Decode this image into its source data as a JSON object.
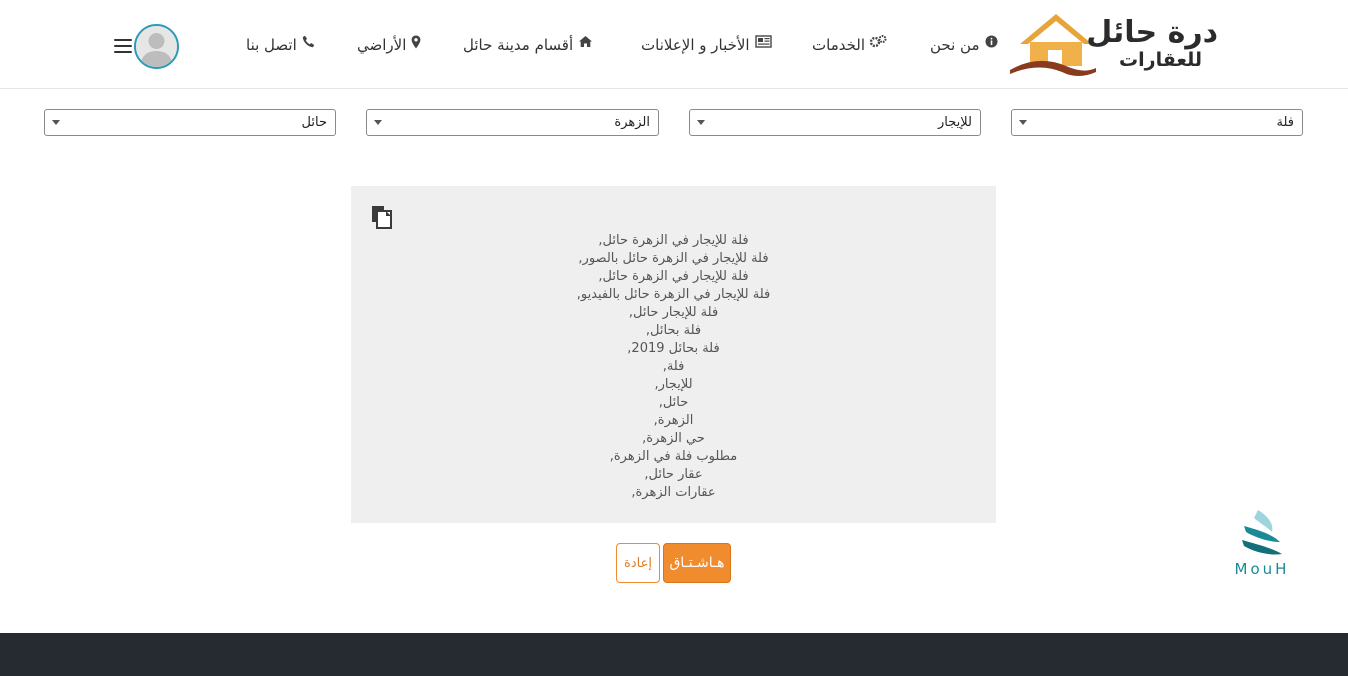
{
  "header": {
    "logo": {
      "title": "درة حائل",
      "subtitle": "للعقارات"
    },
    "nav": [
      {
        "label": "من نحن",
        "icon": "info-circle-icon"
      },
      {
        "label": "الخدمات",
        "icon": "gears-icon"
      },
      {
        "label": "الأخبار و الإعلانات",
        "icon": "newspaper-icon"
      },
      {
        "label": "أقسام مدينة حائل",
        "icon": "home-icon"
      },
      {
        "label": "الأراضي",
        "icon": "map-marker-icon"
      },
      {
        "label": "اتصل بنا",
        "icon": "phone-icon"
      }
    ]
  },
  "filters": {
    "property_type": "فلة",
    "purpose": "للإيجار",
    "district": "الزهرة",
    "city": "حائل"
  },
  "hashtags": [
    "فلة للإيجار في الزهرة حائل,",
    "فلة للإيجار في الزهرة حائل بالصور,",
    "فلة للإيجار في الزهرة حائل,",
    "فلة للإيجار في الزهرة حائل بالفيديو,",
    "فلة للإيجار حائل,",
    "فلة بحائل,",
    "فلة بحائل 2019,",
    "فلة,",
    "للإيجار,",
    "حائل,",
    "الزهرة,",
    "حي الزهرة,",
    "مطلوب فلة في الزهرة,",
    "عقار حائل,",
    "عقارات الزهرة,"
  ],
  "buttons": {
    "hashtag": "هـاشـتـاق",
    "reset": "إعادة"
  },
  "brand_badge": "MouH",
  "colors": {
    "accent": "#f08c2e",
    "avatar_ring": "#2a9cb8",
    "footer": "#262a31",
    "box": "#efefef"
  }
}
